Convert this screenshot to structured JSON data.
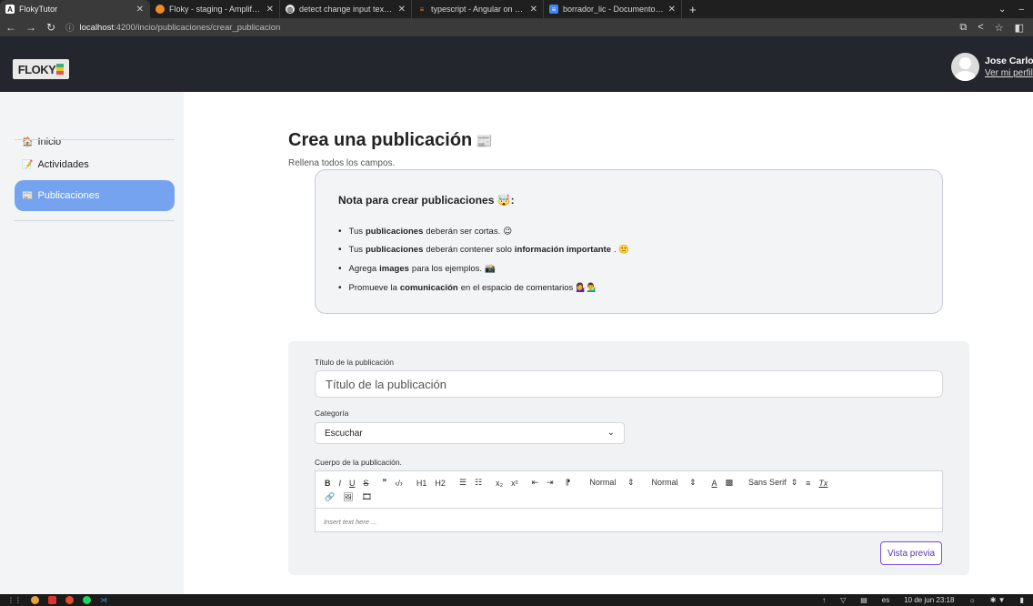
{
  "browser": {
    "tabs": [
      {
        "title": "FlokyTutor",
        "icon": "app-favicon",
        "fav_color": "#ffffff",
        "fav_text": "A",
        "active": true
      },
      {
        "title": "Floky - staging - Amplify Studio",
        "icon": "amplify-favicon",
        "fav_color": "#f08a24",
        "fav_text": "",
        "active": false
      },
      {
        "title": "detect change input text angul",
        "icon": "globe-favicon",
        "fav_color": "#e8e8e8",
        "fav_text": "",
        "active": false
      },
      {
        "title": "typescript - Angular on keyup.e",
        "icon": "stackoverflow-favicon",
        "fav_color": "#f48024",
        "fav_text": "",
        "active": false
      },
      {
        "title": "borrador_lic - Documentos de",
        "icon": "docs-favicon",
        "fav_color": "#4285f4",
        "fav_text": "",
        "active": false
      }
    ],
    "url": {
      "host": "localhost",
      "path": ":4200/incio/publicaciones/crear_publicacion"
    }
  },
  "header": {
    "logo_text": "FLOKY",
    "user_name": "Jose Carlos",
    "profile_link": "Ver mi perfil"
  },
  "sidebar": {
    "items": [
      {
        "label": "Inicio",
        "emoji": "🏠",
        "active": false
      },
      {
        "label": "Actividades",
        "emoji": "📝",
        "active": false
      },
      {
        "label": "Publicaciones",
        "emoji": "📰",
        "active": true
      }
    ]
  },
  "main": {
    "title": "Crea una publicación",
    "title_emoji": "📰",
    "subtitle": "Rellena todos los campos.",
    "note": {
      "title": "Nota para crear publicaciones 🤯:",
      "items": [
        {
          "pre": "Tus ",
          "bold": "publicaciones",
          "mid": " deberán ser cortas.",
          "bold2": "",
          "post": " 😉"
        },
        {
          "pre": "Tus ",
          "bold": "publicaciones",
          "mid": " deberán contener solo ",
          "bold2": "información importante",
          "post": ". 🙂"
        },
        {
          "pre": "Agrega ",
          "bold": "images",
          "mid": " para los ejemplos.",
          "bold2": "",
          "post": " 📸"
        },
        {
          "pre": "Promueve la ",
          "bold": "comunicación",
          "mid": " en el espacio de comentarios",
          "bold2": "",
          "post": " 💁‍♀️💁‍♂️"
        }
      ]
    },
    "form": {
      "title_label": "Título de la publicación",
      "title_placeholder": "Título de la publicación",
      "category_label": "Categoría",
      "category_value": "Escuchar",
      "body_label": "Cuerpo de la publicación.",
      "toolbar_row1": [
        "B",
        "I",
        "U",
        "S",
        "❞",
        "‹/›",
        "H1",
        "H2",
        "☰",
        "☷",
        "x₂",
        "x²",
        "⇤",
        "⇥",
        "⁋"
      ],
      "toolbar_dropdowns": [
        "Normal",
        "Normal"
      ],
      "toolbar_row1_tail": [
        "A",
        "▩",
        "Sans Serif",
        "≡",
        "Tx"
      ],
      "toolbar_row2": [
        "🔗",
        "🖼",
        "🎞"
      ],
      "body_placeholder": "Insert text here ...",
      "preview_button": "Vista previa"
    }
  },
  "taskbar": {
    "lang": "es",
    "datetime": "10 de jun  23:18"
  }
}
